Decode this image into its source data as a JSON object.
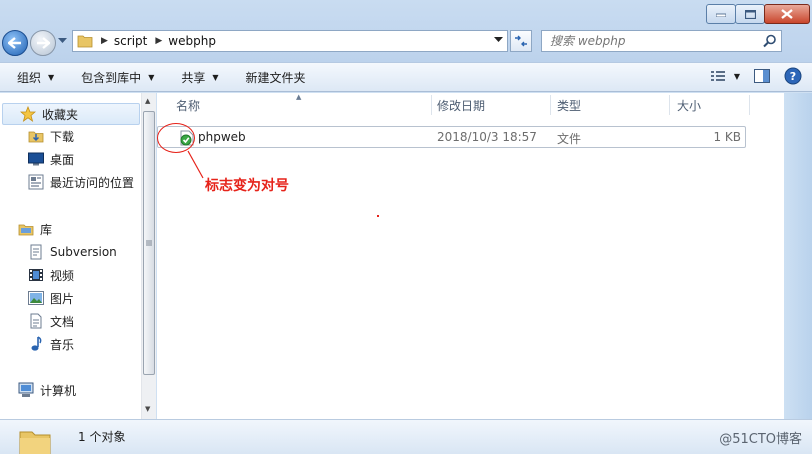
{
  "address": {
    "crumbs": [
      "script",
      "webphp"
    ]
  },
  "search": {
    "placeholder": "搜索 webphp"
  },
  "toolbar": {
    "organize": "组织",
    "include_in_library": "包含到库中",
    "share": "共享",
    "new_folder": "新建文件夹"
  },
  "sidebar": {
    "favorites": "收藏夹",
    "downloads": "下载",
    "desktop": "桌面",
    "recent": "最近访问的位置",
    "libraries": "库",
    "subversion": "Subversion",
    "videos": "视频",
    "pictures": "图片",
    "documents": "文档",
    "music": "音乐",
    "computer": "计算机"
  },
  "columns": {
    "name": "名称",
    "modified": "修改日期",
    "type": "类型",
    "size": "大小"
  },
  "files": [
    {
      "name": "phpweb",
      "modified": "2018/10/3 18:57",
      "type": "文件",
      "size": "1 KB"
    }
  ],
  "annotation": {
    "text": "标志变为对号",
    "color": "#e6231a"
  },
  "status": {
    "count": "1 个对象"
  },
  "watermark": "@51CTO博客",
  "colors": {
    "window_frame": "#cfe0f2",
    "accent_blue": "#1f61b3",
    "svn_ok_green": "#3aa845"
  }
}
